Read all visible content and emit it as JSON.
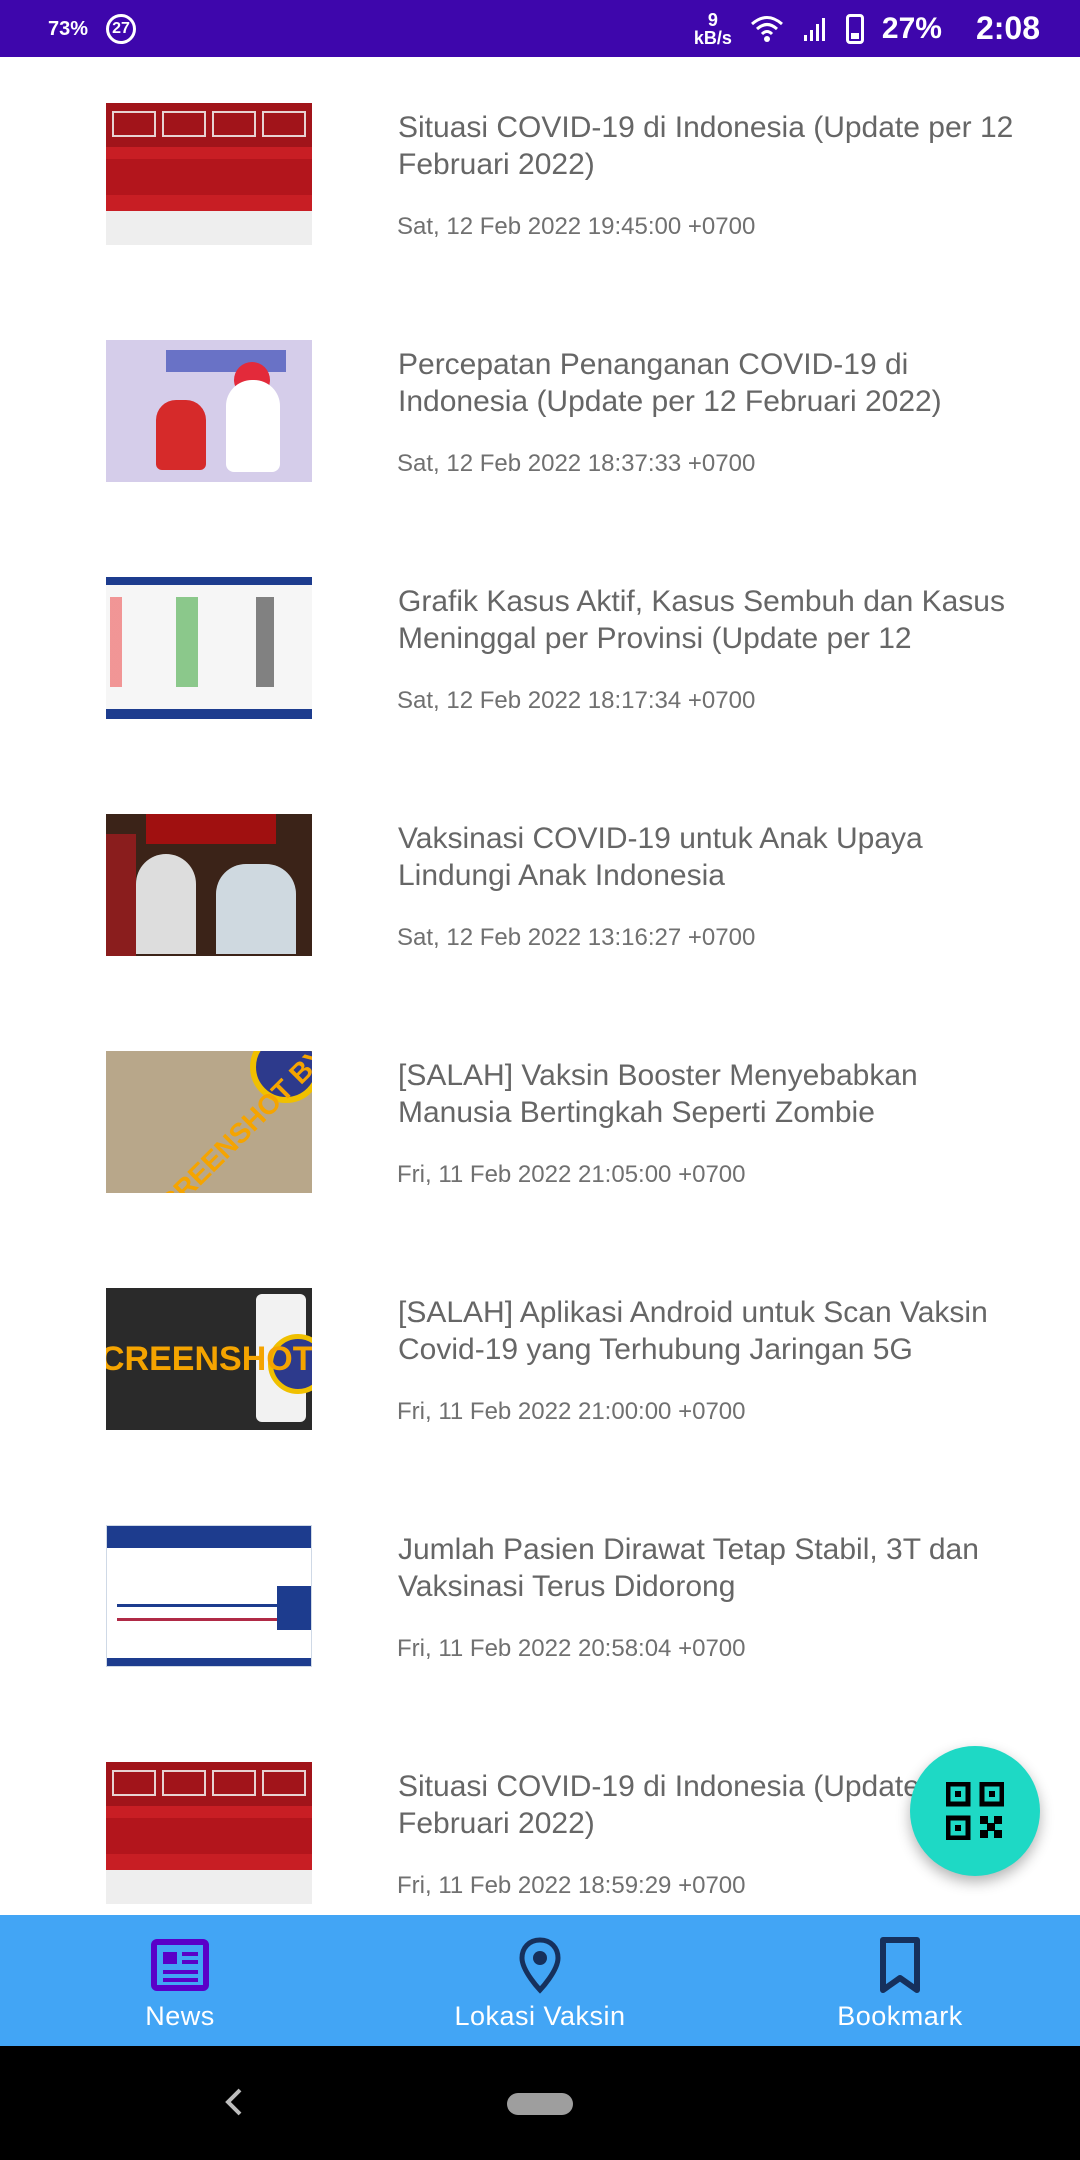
{
  "status_bar": {
    "left_percent": "73%",
    "notif_count": "27",
    "net_speed_value": "9",
    "net_speed_unit": "kB/s",
    "battery": "27%",
    "time": "2:08"
  },
  "news": [
    {
      "title": "Situasi COVID-19 di Indonesia (Update per 12 Februari 2022)",
      "date": "Sat, 12 Feb 2022 19:45:00 +0700",
      "thumb": "red-infographic"
    },
    {
      "title": "Percepatan Penanganan COVID-19 di Indonesia (Update per 12 Februari 2022)",
      "date": "Sat, 12 Feb 2022 18:37:33 +0700",
      "thumb": "lavender-illustration"
    },
    {
      "title": "Grafik Kasus Aktif, Kasus Sembuh dan Kasus Meninggal per Provinsi (Update per 12",
      "date": "Sat, 12 Feb 2022 18:17:34 +0700",
      "thumb": "chart"
    },
    {
      "title": "Vaksinasi COVID-19 untuk Anak Upaya Lindungi Anak Indonesia",
      "date": "Sat, 12 Feb 2022 13:16:27 +0700",
      "thumb": "photo"
    },
    {
      "title": "[SALAH] Vaksin Booster Menyebabkan Manusia Bertingkah Seperti Zombie",
      "date": "Fri, 11 Feb 2022 21:05:00 +0700",
      "thumb": "hoax-beige"
    },
    {
      "title": "[SALAH] Aplikasi Android untuk Scan Vaksin Covid-19 yang Terhubung Jaringan 5G",
      "date": "Fri, 11 Feb 2022 21:00:00 +0700",
      "thumb": "hoax-dark"
    },
    {
      "title": "Jumlah Pasien Dirawat Tetap Stabil, 3T dan Vaksinasi Terus Didorong",
      "date": "Fri, 11 Feb 2022 20:58:04 +0700",
      "thumb": "line-chart"
    },
    {
      "title": "Situasi COVID-19 di Indonesia (Update per 11 Februari 2022)",
      "date": "Fri, 11 Feb 2022 18:59:29 +0700",
      "thumb": "red-infographic"
    }
  ],
  "thumb_text": {
    "beige": "SCREENSHOT BY",
    "dark": "CREENSHOT BY"
  },
  "fab": {
    "icon": "qr-code-icon"
  },
  "bottom_nav": {
    "news": "News",
    "lokasi": "Lokasi Vaksin",
    "bookmark": "Bookmark"
  },
  "colors": {
    "status_bar": "#3e06ac",
    "bottom_nav": "#42a5f5",
    "fab": "#1ed9c5",
    "active_icon": "#5a00c8"
  }
}
